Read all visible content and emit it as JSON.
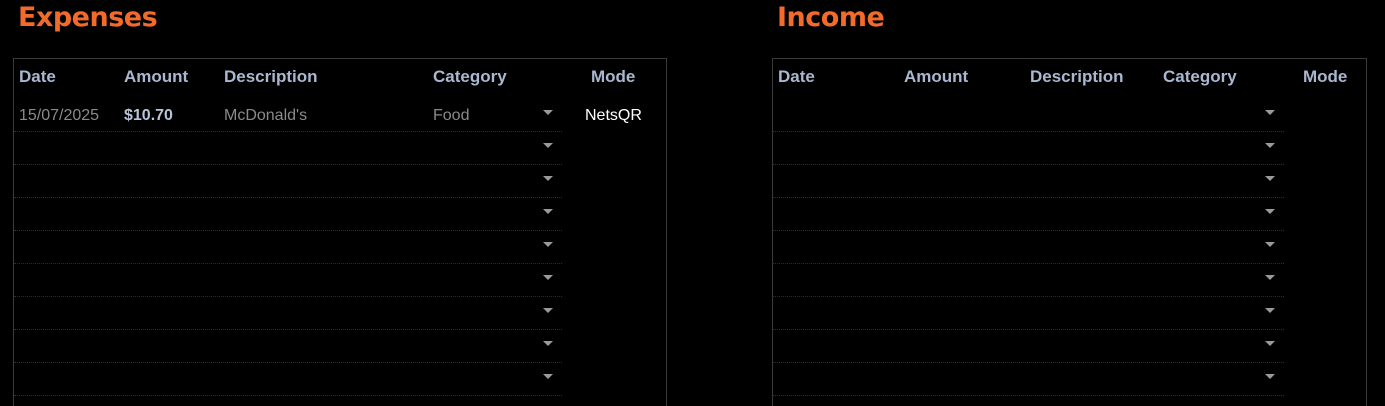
{
  "expenses": {
    "title": "Expenses",
    "headers": {
      "date": "Date",
      "amount": "Amount",
      "description": "Description",
      "category": "Category",
      "mode": "Mode"
    },
    "rows": [
      {
        "date": "15/07/2025",
        "amount": "$10.70",
        "description": "McDonald's",
        "category": "Food",
        "mode": "NetsQR"
      },
      {
        "date": "",
        "amount": "",
        "description": "",
        "category": "",
        "mode": ""
      },
      {
        "date": "",
        "amount": "",
        "description": "",
        "category": "",
        "mode": ""
      },
      {
        "date": "",
        "amount": "",
        "description": "",
        "category": "",
        "mode": ""
      },
      {
        "date": "",
        "amount": "",
        "description": "",
        "category": "",
        "mode": ""
      },
      {
        "date": "",
        "amount": "",
        "description": "",
        "category": "",
        "mode": ""
      },
      {
        "date": "",
        "amount": "",
        "description": "",
        "category": "",
        "mode": ""
      },
      {
        "date": "",
        "amount": "",
        "description": "",
        "category": "",
        "mode": ""
      },
      {
        "date": "",
        "amount": "",
        "description": "",
        "category": "",
        "mode": ""
      }
    ]
  },
  "income": {
    "title": "Income",
    "headers": {
      "date": "Date",
      "amount": "Amount",
      "description": "Description",
      "category": "Category",
      "mode": "Mode"
    },
    "rows": [
      {
        "date": "",
        "amount": "",
        "description": "",
        "category": "",
        "mode": ""
      },
      {
        "date": "",
        "amount": "",
        "description": "",
        "category": "",
        "mode": ""
      },
      {
        "date": "",
        "amount": "",
        "description": "",
        "category": "",
        "mode": ""
      },
      {
        "date": "",
        "amount": "",
        "description": "",
        "category": "",
        "mode": ""
      },
      {
        "date": "",
        "amount": "",
        "description": "",
        "category": "",
        "mode": ""
      },
      {
        "date": "",
        "amount": "",
        "description": "",
        "category": "",
        "mode": ""
      },
      {
        "date": "",
        "amount": "",
        "description": "",
        "category": "",
        "mode": ""
      },
      {
        "date": "",
        "amount": "",
        "description": "",
        "category": "",
        "mode": ""
      },
      {
        "date": "",
        "amount": "",
        "description": "",
        "category": "",
        "mode": ""
      }
    ]
  },
  "colors": {
    "title_accent": "#f26b2a",
    "header_text": "#a9b8d0",
    "background": "#000000"
  }
}
